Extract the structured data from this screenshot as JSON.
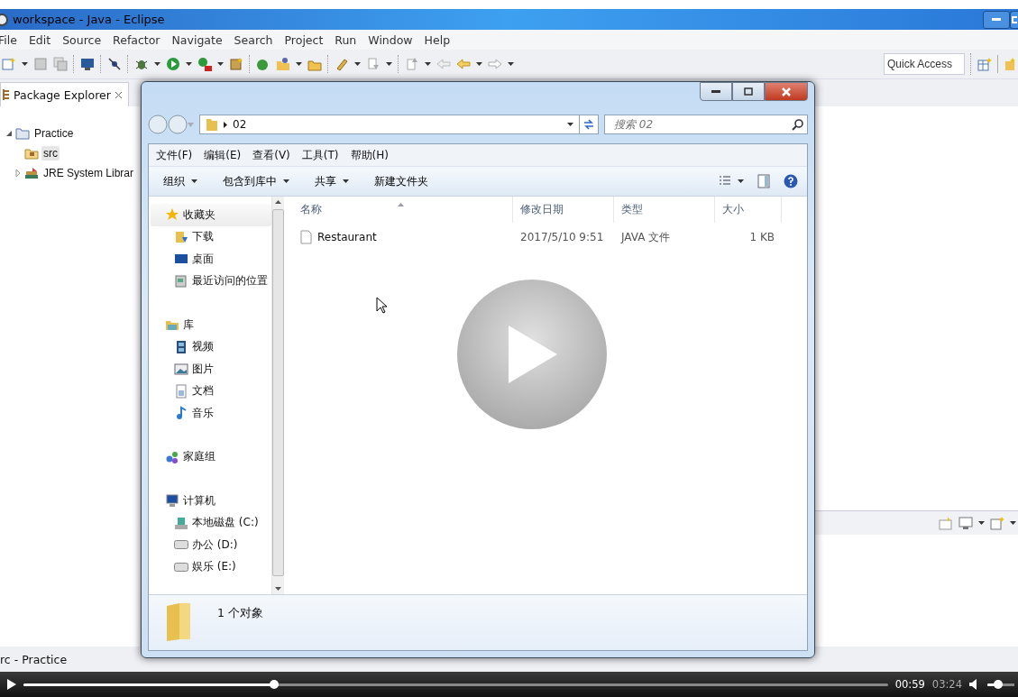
{
  "eclipse": {
    "title": "workspace - Java - Eclipse",
    "menu": [
      "File",
      "Edit",
      "Source",
      "Refactor",
      "Navigate",
      "Search",
      "Project",
      "Run",
      "Window",
      "Help"
    ],
    "quick_access": {
      "placeholder": "Quick Access"
    },
    "package_explorer": {
      "tab": "Package Explorer",
      "tree": [
        {
          "label": "Practice",
          "kind": "project",
          "expanded": true,
          "children": [
            {
              "label": "src",
              "kind": "source",
              "selected": true
            },
            {
              "label": "JRE System Librar",
              "kind": "library",
              "expanded": false,
              "selected": false
            }
          ]
        }
      ]
    },
    "status_bar": "rc - Practice"
  },
  "explorer": {
    "address": "02",
    "search": {
      "placeholder": "搜索 02"
    },
    "menu": [
      "文件(F)",
      "编辑(E)",
      "查看(V)",
      "工具(T)",
      "帮助(H)"
    ],
    "commands": [
      {
        "label": "组织",
        "dropdown": true
      },
      {
        "label": "包含到库中",
        "dropdown": true
      },
      {
        "label": "共享",
        "dropdown": true
      },
      {
        "label": "新建文件夹",
        "dropdown": false
      }
    ],
    "nav": [
      {
        "label": "收藏夹",
        "kind": "star",
        "selected": true,
        "children": [
          {
            "label": "下载",
            "kind": "download",
            "selected": false
          },
          {
            "label": "桌面",
            "kind": "desktop",
            "selected": false
          },
          {
            "label": "最近访问的位置",
            "kind": "recent",
            "selected": false
          }
        ]
      },
      {
        "label": "库",
        "kind": "library",
        "selected": false,
        "children": [
          {
            "label": "视频",
            "kind": "video",
            "selected": false
          },
          {
            "label": "图片",
            "kind": "picture",
            "selected": false
          },
          {
            "label": "文档",
            "kind": "document",
            "selected": false
          },
          {
            "label": "音乐",
            "kind": "music",
            "selected": false
          }
        ]
      },
      {
        "label": "家庭组",
        "kind": "homegroup",
        "selected": false
      },
      {
        "label": "计算机",
        "kind": "computer",
        "selected": false,
        "children": [
          {
            "label": "本地磁盘 (C:)",
            "kind": "system-drive",
            "selected": false
          },
          {
            "label": "办公 (D:)",
            "kind": "drive",
            "selected": false
          },
          {
            "label": "娱乐 (E:)",
            "kind": "drive",
            "selected": false
          }
        ]
      }
    ],
    "columns": [
      {
        "label": "名称",
        "sorted": true
      },
      {
        "label": "修改日期",
        "sorted": false
      },
      {
        "label": "类型",
        "sorted": false
      },
      {
        "label": "大小",
        "sorted": false
      }
    ],
    "files": [
      {
        "name": "Restaurant",
        "modified": "2017/5/10 9:51",
        "type": "JAVA 文件",
        "size": "1 KB",
        "selected": false
      }
    ],
    "details": "1 个对象"
  },
  "player": {
    "level": 0.29,
    "current": "00:59",
    "total": "03:24",
    "volume": {
      "level": 0.4
    }
  }
}
